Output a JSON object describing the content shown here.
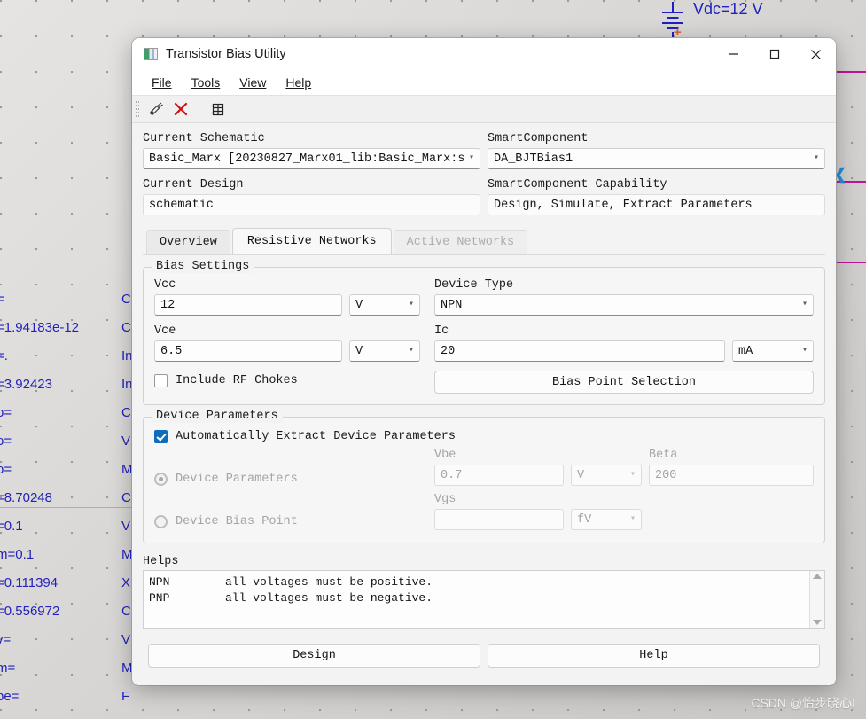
{
  "background": {
    "vdc_label": "Vdc=12 V",
    "plus_sign": "+",
    "arrow_glyph": "❮",
    "watermark": "CSDN @怡步晓心I",
    "param_rows": [
      {
        "value": "=",
        "label": "C"
      },
      {
        "value": "=1.94183e-12",
        "label": "C"
      },
      {
        "value": "=.",
        "label": "In"
      },
      {
        "value": "=3.92423",
        "label": "In"
      },
      {
        "value": "o=",
        "label": "C"
      },
      {
        "value": "o=",
        "label": "V"
      },
      {
        "value": "o=",
        "label": "M"
      },
      {
        "value": "=8.70248",
        "label": "C"
      },
      {
        "value": "=0.1",
        "label": "V"
      },
      {
        "value": "m=0.1",
        "label": "M"
      },
      {
        "value": "=0.111394",
        "label": "X"
      },
      {
        "value": "=0.556972",
        "label": "C"
      },
      {
        "value": "v=",
        "label": "V"
      },
      {
        "value": "m=",
        "label": "M"
      },
      {
        "value": "pe=",
        "label": "F"
      }
    ]
  },
  "window": {
    "title": "Transistor Bias Utility",
    "icon": "picture-icon",
    "minimize": "minimize-icon",
    "maximize": "maximize-icon",
    "close": "close-icon"
  },
  "menu": [
    {
      "label": "File",
      "mnemonic": "F"
    },
    {
      "label": "Tools",
      "mnemonic": "T"
    },
    {
      "label": "View",
      "mnemonic": "V"
    },
    {
      "label": "Help",
      "mnemonic": "H"
    }
  ],
  "toolbar": [
    {
      "name": "design-tool-icon",
      "title": "Design"
    },
    {
      "name": "delete-icon",
      "title": "Delete"
    },
    {
      "name": "table-icon",
      "title": "Table"
    }
  ],
  "top": {
    "current_schematic_label": "Current Schematic",
    "current_schematic_value": "Basic_Marx [20230827_Marx01_lib:Basic_Marx:s",
    "current_design_label": "Current Design",
    "current_design_value": "schematic",
    "smartcomponent_label": "SmartComponent",
    "smartcomponent_value": "DA_BJTBias1",
    "capability_label": "SmartComponent Capability",
    "capability_value": "Design, Simulate, Extract Parameters"
  },
  "tabs": [
    {
      "label": "Overview",
      "state": "inactive"
    },
    {
      "label": "Resistive Networks",
      "state": "active"
    },
    {
      "label": "Active Networks",
      "state": "disabled"
    }
  ],
  "bias_settings": {
    "legend": "Bias Settings",
    "vcc_label": "Vcc",
    "vcc_value": "12",
    "vcc_unit": "V",
    "vce_label": "Vce",
    "vce_value": "6.5",
    "vce_unit": "V",
    "include_rf_chokes_label": "Include RF Chokes",
    "include_rf_chokes_checked": false,
    "device_type_label": "Device Type",
    "device_type_value": "NPN",
    "ic_label": "Ic",
    "ic_value": "20",
    "ic_unit": "mA",
    "bias_point_button": "Bias Point Selection"
  },
  "device_parameters": {
    "legend": "Device Parameters",
    "auto_extract_label": "Automatically Extract Device Parameters",
    "auto_extract_checked": true,
    "radio_device_parameters": "Device Parameters",
    "radio_device_bias_point": "Device Bias Point",
    "vbe_label": "Vbe",
    "vbe_value": "0.7",
    "vbe_unit": "V",
    "beta_label": "Beta",
    "beta_value": "200",
    "vgs_label": "Vgs",
    "vgs_value": "",
    "vgs_unit": "fV"
  },
  "helps": {
    "legend": "Helps",
    "rows": [
      {
        "key": "NPN",
        "text": "all voltages must be positive."
      },
      {
        "key": "PNP",
        "text": "all voltages must be negative."
      }
    ],
    "scroll_up": "scroll-up-icon",
    "scroll_down": "scroll-down-icon"
  },
  "footer": {
    "design_button": "Design",
    "help_button": "Help"
  },
  "colors": {
    "accent": "#0f6cbd",
    "wire": "#c3129b",
    "schematic_text": "#2222bb",
    "delete_icon": "#cc1414"
  }
}
